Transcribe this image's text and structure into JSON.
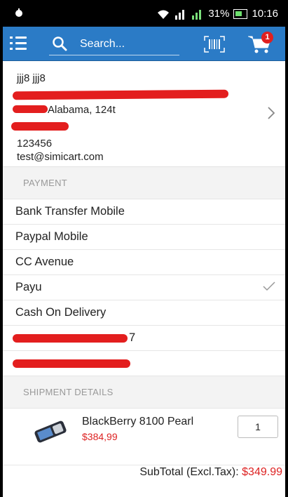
{
  "status_bar": {
    "battery_percent": "31%",
    "time": "10:16"
  },
  "toolbar": {
    "search_placeholder": "Search...",
    "cart_count": "1"
  },
  "address": {
    "name": "jjj8 jjj8",
    "line_city": "Alabama, 124t",
    "phone": "123456",
    "email": "test@simicart.com"
  },
  "payment": {
    "header": "PAYMENT",
    "methods": [
      "Bank Transfer Mobile",
      "Paypal Mobile",
      "CC Avenue",
      "Payu",
      "Cash On Delivery"
    ],
    "selected": "Payu",
    "redacted_suffix": "7"
  },
  "shipment": {
    "header": "SHIPMENT DETAILS",
    "product_name": "BlackBerry 8100 Pearl",
    "product_price": "$384,99",
    "quantity": "1"
  },
  "totals": {
    "subtotal_label": "SubTotal (Excl.Tax):",
    "subtotal_value": "$349.99"
  },
  "colors": {
    "toolbar": "#2b7bc6",
    "accent_red": "#e31e1e",
    "price_red": "#d22222"
  }
}
